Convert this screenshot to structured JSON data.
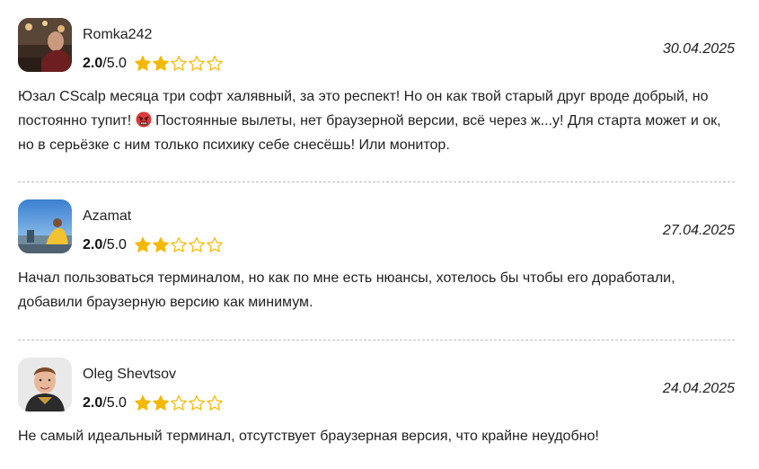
{
  "rating_color": "#f5b800",
  "star_empty_color": "#f5b800",
  "reviews": [
    {
      "author": "Romka242",
      "rating_value": "2.0",
      "rating_max": "/5.0",
      "rating": 2,
      "date": "30.04.2025",
      "text_before_emoji": "Юзал CScalp месяца три софт халявный, за это респект! Но он как твой старый друг вроде добрый, но постоянно тупит! ",
      "emoji": "angry-face-icon",
      "text_after_emoji": " Постоянные вылеты, нет браузерной версии, всё через ж...у! Для старта может и ок, но в серьёзке с ним только психику себе снесёшь! Или монитор."
    },
    {
      "author": "Azamat",
      "rating_value": "2.0",
      "rating_max": "/5.0",
      "rating": 2,
      "date": "27.04.2025",
      "text": "Начал пользоваться терминалом, но как по мне есть нюансы, хотелось бы чтобы его доработали, добавили браузерную версию как минимум."
    },
    {
      "author": "Oleg Shevtsov",
      "rating_value": "2.0",
      "rating_max": "/5.0",
      "rating": 2,
      "date": "24.04.2025",
      "text": "Не самый идеальный терминал, отсутствует браузерная версия, что крайне неудобно!"
    }
  ]
}
